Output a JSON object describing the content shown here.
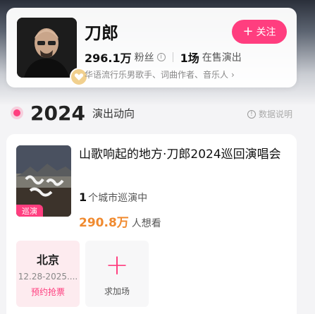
{
  "artist": {
    "name": "刀郎",
    "follow_label": "关注",
    "fans_count": "296.1万",
    "fans_label": "粉丝",
    "shows_count": "1场",
    "shows_label": "在售演出",
    "tags": "华语流行乐男歌手、词曲作者、音乐人",
    "verified_icon": "heart-badge-icon"
  },
  "timeline": {
    "year": "2024",
    "title": "演出动向",
    "data_note": "数据说明"
  },
  "event": {
    "title": "山歌响起的地方·刀郎2024巡回演唱会",
    "poster_tag": "巡演",
    "city_count": "1",
    "city_count_label": "个城市巡演中",
    "want_count": "290.8万",
    "want_label": "人想看",
    "cities": [
      {
        "name": "北京",
        "date": "12.28-2025....",
        "action": "预约抢票"
      }
    ],
    "request_label": "求加场"
  },
  "colors": {
    "accent": "#ff3e7f",
    "want_number": "#f08a2f"
  }
}
